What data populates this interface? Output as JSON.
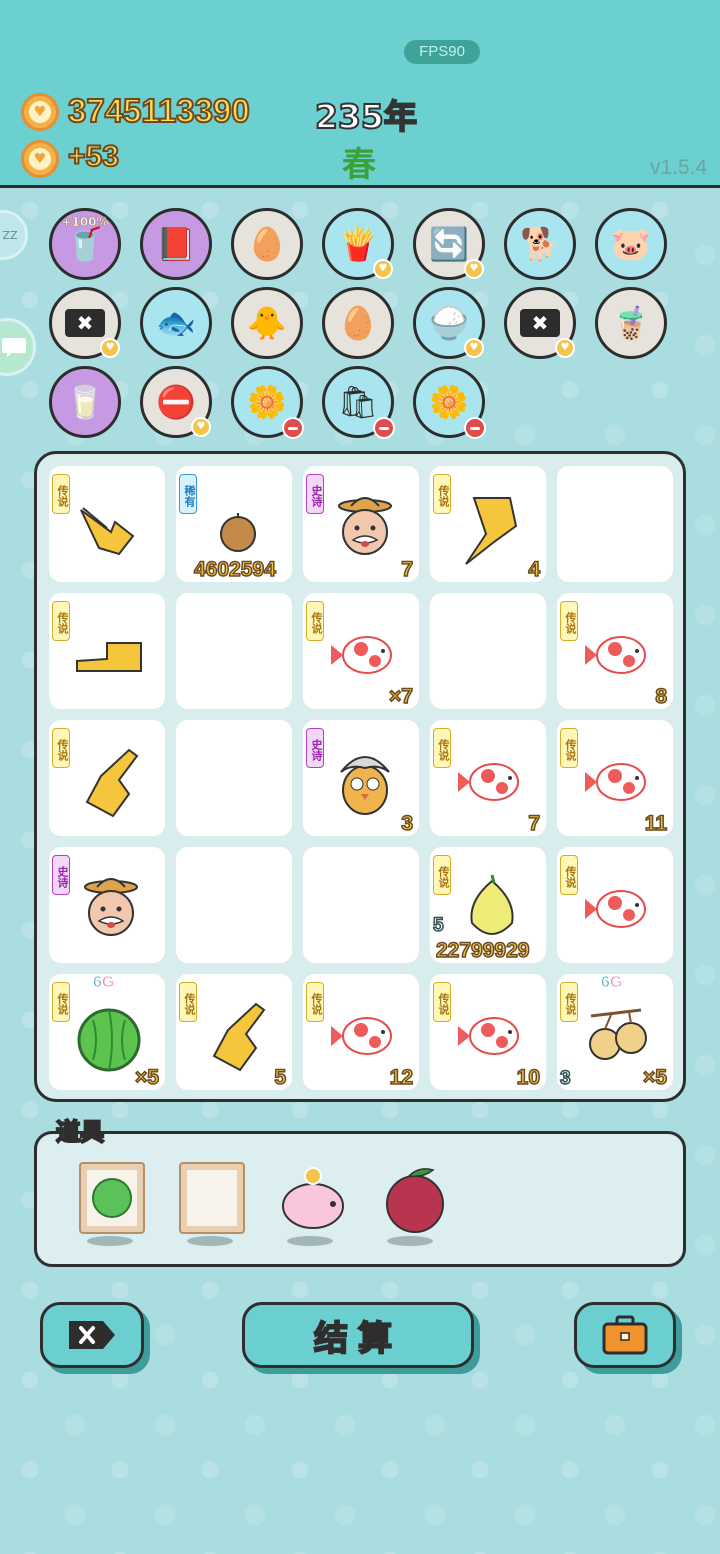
{
  "header": {
    "fps": "FPS90",
    "coins": "3745113390",
    "coin_rate": "+53",
    "year": "235年",
    "season": "春",
    "version": "v1.5.4"
  },
  "side": {
    "sleep_label": "ZZ",
    "chat_icon": "chat-bubble-icon"
  },
  "icon_rows": [
    [
      {
        "name": "tea-cup",
        "color": "purple",
        "label": "+100%"
      },
      {
        "name": "quest-card",
        "color": "purple"
      },
      {
        "name": "egg-tray",
        "color": "gray"
      },
      {
        "name": "fries",
        "color": "blue",
        "heart": true
      },
      {
        "name": "refresh",
        "color": "gray",
        "heart": true
      },
      {
        "name": "shiba-dog",
        "color": "blue"
      },
      {
        "name": "piggy-bank",
        "color": "blue"
      }
    ],
    [
      {
        "name": "delete-tag",
        "color": "gray",
        "heart": true
      },
      {
        "name": "fish-tank",
        "color": "blue"
      },
      {
        "name": "chick",
        "color": "gray"
      },
      {
        "name": "egg-tray",
        "color": "gray"
      },
      {
        "name": "rice-bowl",
        "color": "blue",
        "heart": true
      },
      {
        "name": "delete-tag",
        "color": "gray",
        "heart": true
      },
      {
        "name": "bubble-tea",
        "color": "gray"
      }
    ],
    [
      {
        "name": "milk-jar",
        "color": "purple"
      },
      {
        "name": "no-entry",
        "color": "gray",
        "heart": true
      },
      {
        "name": "flower-pot",
        "color": "blue",
        "minus": true
      },
      {
        "name": "fertilizer-bag",
        "color": "blue",
        "minus": true
      },
      {
        "name": "flower-pot",
        "color": "blue",
        "minus": true
      }
    ]
  ],
  "tags": {
    "legend": "传说",
    "epic": "史诗",
    "rare": "稀有"
  },
  "grid": [
    [
      {
        "tag": "legend",
        "item": "pointing-hand-right-down",
        "count": ""
      },
      {
        "tag": "rare",
        "item": "nut",
        "big": "4602594"
      },
      {
        "tag": "epic",
        "item": "farmer-grandpa",
        "count": "7"
      },
      {
        "tag": "legend",
        "item": "pointing-hand-down-left",
        "count": "4"
      },
      {
        "item": "empty"
      }
    ],
    [
      {
        "tag": "legend",
        "item": "pointing-hand-left",
        "count": ""
      },
      {
        "item": "empty"
      },
      {
        "tag": "legend",
        "item": "koi-fish",
        "count": "×7"
      },
      {
        "item": "empty"
      },
      {
        "tag": "legend",
        "item": "koi-fish",
        "count": "8"
      }
    ],
    [
      {
        "tag": "legend",
        "item": "pointing-hand-up",
        "count": ""
      },
      {
        "item": "empty"
      },
      {
        "tag": "epic",
        "item": "grey-hair-chick",
        "count": "3"
      },
      {
        "tag": "legend",
        "item": "koi-fish",
        "count": "7"
      },
      {
        "tag": "legend",
        "item": "koi-fish",
        "count": "11"
      }
    ],
    [
      {
        "tag": "epic",
        "item": "farmer-grandpa",
        "count": ""
      },
      {
        "item": "empty"
      },
      {
        "item": "empty"
      },
      {
        "tag": "legend",
        "item": "pomelo",
        "left": "5",
        "big": "22799929"
      },
      {
        "tag": "legend",
        "item": "koi-fish",
        "count": ""
      }
    ],
    [
      {
        "tag": "legend",
        "item": "watermelon",
        "count": "×5",
        "g6": true
      },
      {
        "tag": "legend",
        "item": "pointing-hand-up",
        "count": "5"
      },
      {
        "tag": "legend",
        "item": "koi-fish",
        "count": "12"
      },
      {
        "tag": "legend",
        "item": "koi-fish",
        "count": "10"
      },
      {
        "tag": "legend",
        "item": "longan",
        "left": "3",
        "count": "×5",
        "g6": true
      }
    ]
  ],
  "g6_label": {
    "num": "6",
    "unit": "G"
  },
  "props": {
    "title": "道具",
    "items": [
      "watermelon-frame",
      "empty-frame",
      "piggy-bank",
      "bayberry"
    ]
  },
  "buttons": {
    "delete_icon": "delete-tag-icon",
    "settle": "结算",
    "bag_icon": "briefcase-icon"
  },
  "colors": {
    "header": "#6ccfd0",
    "legend_tag": "#d6ae26",
    "epic_tag": "#b342c2",
    "rare_tag": "#3a9ad8",
    "count_text": "#f5c94a"
  }
}
